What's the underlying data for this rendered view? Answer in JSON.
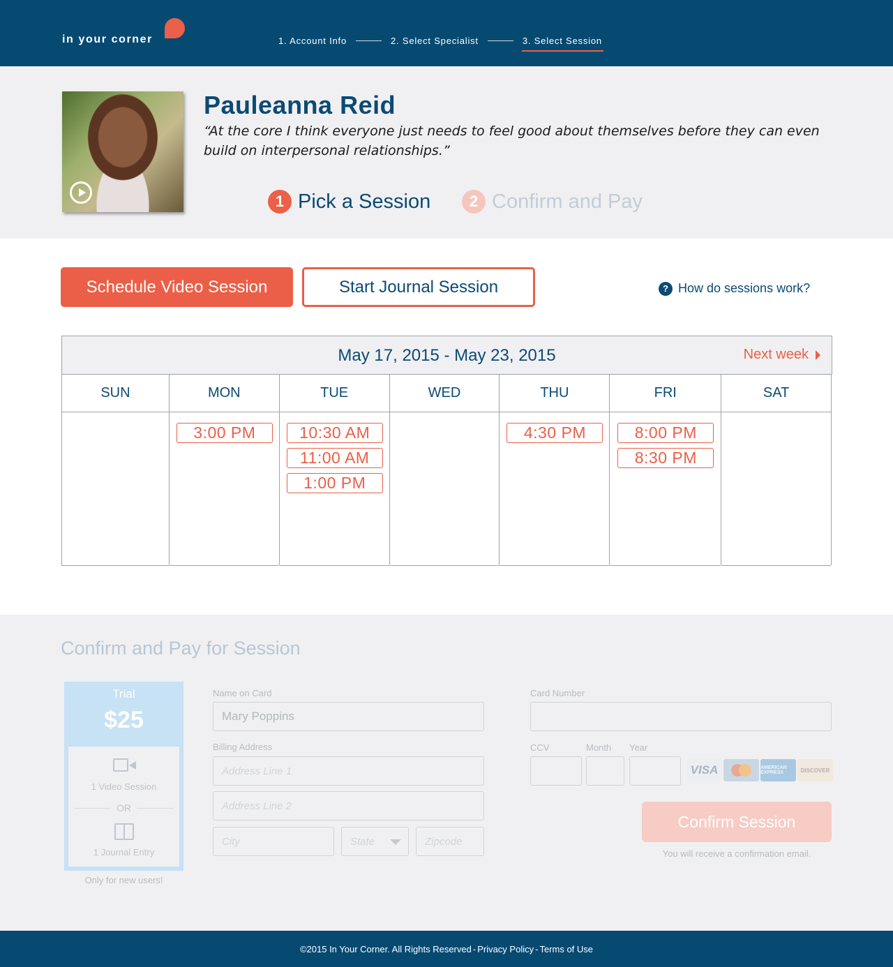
{
  "header": {
    "logo": "in your corner",
    "steps": [
      "1. Account Info",
      "2. Select Specialist",
      "3. Select Session"
    ]
  },
  "profile": {
    "name": "Pauleanna Reid",
    "quote": "“At the core I think everyone just needs to feel good about themselves before they can even build on interpersonal relationships.”",
    "sub_steps": [
      {
        "num": "1",
        "label": "Pick a Session"
      },
      {
        "num": "2",
        "label": "Confirm and Pay"
      }
    ]
  },
  "session_buttons": {
    "video": "Schedule Video Session",
    "journal": "Start Journal Session",
    "help_icon": "?",
    "help": "How do sessions work?"
  },
  "calendar": {
    "range": "May 17, 2015  - May 23, 2015",
    "next_week": "Next week",
    "days": [
      {
        "name": "SUN",
        "slots": []
      },
      {
        "name": "MON",
        "slots": [
          "3:00 PM"
        ]
      },
      {
        "name": "TUE",
        "slots": [
          "10:30 AM",
          "11:00 AM",
          "1:00 PM"
        ]
      },
      {
        "name": "WED",
        "slots": []
      },
      {
        "name": "THU",
        "slots": [
          "4:30 PM"
        ]
      },
      {
        "name": "FRI",
        "slots": [
          "8:00 PM",
          "8:30 PM"
        ]
      },
      {
        "name": "SAT",
        "slots": []
      }
    ]
  },
  "pay": {
    "title": "Confirm and Pay for Session",
    "trial": {
      "label": "Trial",
      "price": "$25",
      "video": "1 Video Session",
      "or": "OR",
      "journal": "1 Journal Entry",
      "note": "Only for new users!"
    },
    "name_label": "Name on Card",
    "name_value": "Mary Poppins",
    "billing_label": "Billing Address",
    "address1_placeholder": "Address Line 1",
    "address2_placeholder": "Address Line 2",
    "city_placeholder": "City",
    "state_placeholder": "State",
    "zip_placeholder": "Zipcode",
    "card_label": "Card Number",
    "ccv_label": "CCV",
    "month_label": "Month",
    "year_label": "Year",
    "card_brands": [
      "VISA",
      "MasterCard",
      "AMERICAN EXPRESS",
      "DISCOVER"
    ],
    "confirm_button": "Confirm Session",
    "confirm_note": "You will receive a confirmation email."
  },
  "footer": {
    "copyright": "©2015 In Your Corner. All Rights Reserved",
    "sep": "-",
    "privacy": "Privacy Policy",
    "terms": "Terms of Use"
  }
}
